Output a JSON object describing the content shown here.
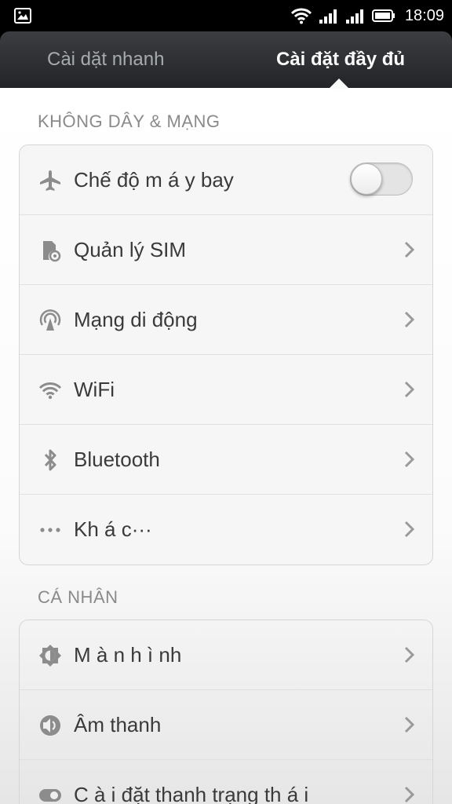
{
  "status_bar": {
    "time": "18:09",
    "icons": [
      "image-icon",
      "wifi-icon",
      "signal-icon",
      "signal-icon",
      "battery-icon"
    ]
  },
  "tabs": {
    "quick": "Cài dặt nhanh",
    "full": "Cài đặt đầy đủ",
    "active": "full"
  },
  "sections": {
    "wireless": {
      "title": "KHÔNG DÂY & MẠNG",
      "items": [
        {
          "icon": "airplane-icon",
          "label": "Chế độ m á y bay",
          "control": "toggle",
          "toggle_on": false
        },
        {
          "icon": "sim-card-icon",
          "label": "Quản lý SIM",
          "control": "chevron"
        },
        {
          "icon": "cell-tower-icon",
          "label": "Mạng di động",
          "control": "chevron"
        },
        {
          "icon": "wifi-icon",
          "label": "WiFi",
          "control": "chevron"
        },
        {
          "icon": "bluetooth-icon",
          "label": "Bluetooth",
          "control": "chevron"
        },
        {
          "icon": "more-dots-icon",
          "label": "Kh á c···",
          "control": "chevron"
        }
      ]
    },
    "personal": {
      "title": "CÁ NHÂN",
      "items": [
        {
          "icon": "brightness-icon",
          "label": "M à n h ì nh",
          "control": "chevron"
        },
        {
          "icon": "speaker-icon",
          "label": "Âm thanh",
          "control": "chevron"
        },
        {
          "icon": "statusbar-toggle-icon",
          "label": "C à i đặt thanh trạng th á i",
          "control": "chevron"
        }
      ]
    }
  },
  "colors": {
    "header_bg": "#2e3033",
    "active_tab_text": "#fafafa",
    "inactive_tab_text": "#a8abae",
    "section_title": "#8a8a8a",
    "row_text": "#3a3a3a",
    "icon_gray": "#8c8c8c"
  }
}
